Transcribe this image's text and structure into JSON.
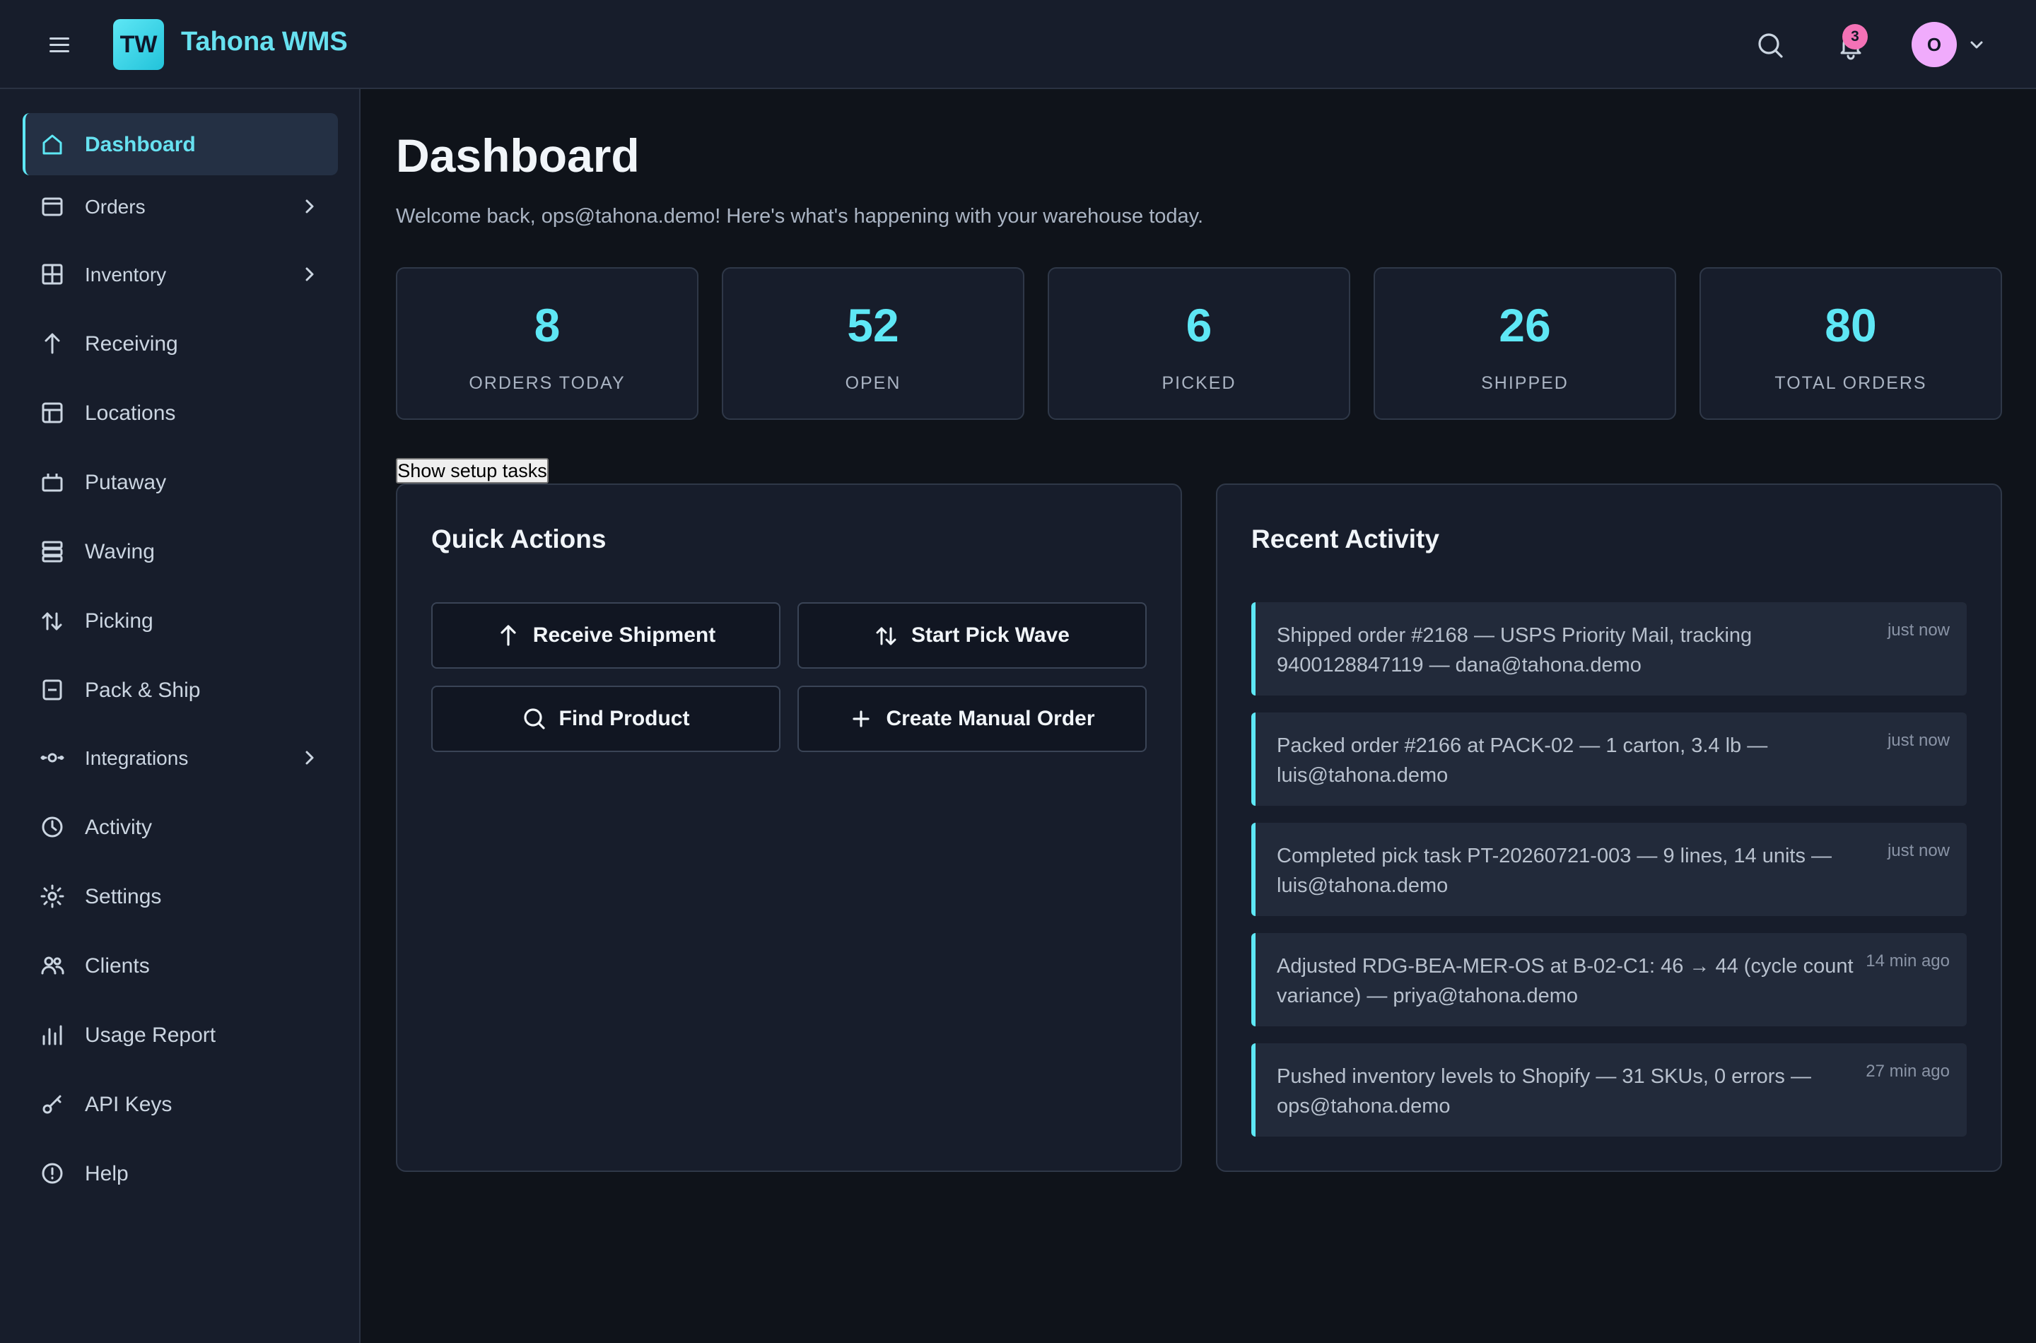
{
  "app": {
    "logo_text": "TW",
    "title": "Tahona WMS",
    "notification_count": "3",
    "avatar_initial": "O",
    "accent_color": "#5ee7f5"
  },
  "sidebar": {
    "items": [
      {
        "label": "Dashboard",
        "icon": "home-icon",
        "active": true
      },
      {
        "label": "Orders",
        "icon": "orders-icon",
        "has_submenu": true
      },
      {
        "label": "Inventory",
        "icon": "inventory-grid-icon",
        "has_submenu": true
      },
      {
        "label": "Receiving",
        "icon": "arrow-up-icon"
      },
      {
        "label": "Locations",
        "icon": "locations-grid-icon"
      },
      {
        "label": "Putaway",
        "icon": "putaway-box-icon"
      },
      {
        "label": "Waving",
        "icon": "waving-stack-icon"
      },
      {
        "label": "Picking",
        "icon": "picking-arrows-icon"
      },
      {
        "label": "Pack & Ship",
        "icon": "package-icon"
      },
      {
        "label": "Integrations",
        "icon": "integrations-plug-icon",
        "has_submenu": true
      },
      {
        "label": "Activity",
        "icon": "clock-icon"
      },
      {
        "label": "Settings",
        "icon": "gear-icon"
      },
      {
        "label": "Clients",
        "icon": "users-icon"
      },
      {
        "label": "Usage Report",
        "icon": "bar-chart-icon"
      },
      {
        "label": "API Keys",
        "icon": "key-icon"
      },
      {
        "label": "Help",
        "icon": "help-circle-icon"
      }
    ]
  },
  "main": {
    "title": "Dashboard",
    "welcome": "Welcome back, ops@tahona.demo! Here's what's happening with your warehouse today.",
    "stats": [
      {
        "value": "8",
        "label": "ORDERS TODAY"
      },
      {
        "value": "52",
        "label": "OPEN"
      },
      {
        "value": "6",
        "label": "PICKED"
      },
      {
        "value": "26",
        "label": "SHIPPED"
      },
      {
        "value": "80",
        "label": "TOTAL ORDERS"
      }
    ],
    "setup_button": "Show setup tasks",
    "quick_actions": {
      "title": "Quick Actions",
      "buttons": [
        {
          "label": "Receive Shipment",
          "icon": "arrow-up-icon"
        },
        {
          "label": "Start Pick Wave",
          "icon": "picking-arrows-icon"
        },
        {
          "label": "Find Product",
          "icon": "search-icon"
        },
        {
          "label": "Create Manual Order",
          "icon": "plus-icon"
        }
      ]
    },
    "recent_activity": {
      "title": "Recent Activity",
      "items": [
        {
          "text": "Shipped order #2168 — USPS Priority Mail, tracking 9400128847119 — dana@tahona.demo",
          "time": "just now"
        },
        {
          "text": "Packed order #2166 at PACK-02 — 1 carton, 3.4 lb — luis@tahona.demo",
          "time": "just now"
        },
        {
          "text": "Completed pick task PT-20260721-003 — 9 lines, 14 units — luis@tahona.demo",
          "time": "just now"
        },
        {
          "text": "Adjusted RDG-BEA-MER-OS at B-02-C1: 46 → 44 (cycle count variance) — priya@tahona.demo",
          "time": "14 min ago"
        },
        {
          "text": "Pushed inventory levels to Shopify — 31 SKUs, 0 errors — ops@tahona.demo",
          "time": "27 min ago"
        }
      ]
    }
  }
}
